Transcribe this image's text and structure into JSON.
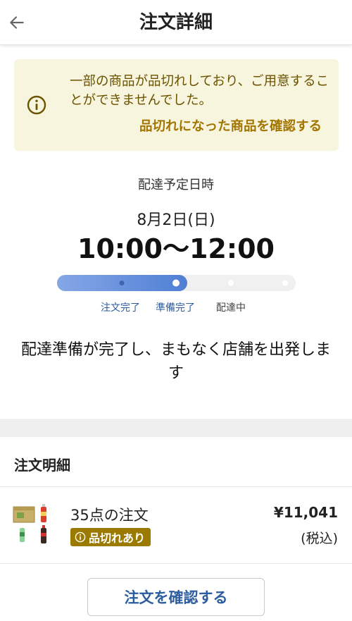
{
  "header": {
    "title": "注文詳細",
    "back_icon": "arrow-left-icon"
  },
  "alert": {
    "message": "一部の商品が品切れしており、ご用意することができませんでした。",
    "link_label": "品切れになった商品を確認する",
    "icon": "info-icon",
    "colors": {
      "background": "#f8f5de",
      "text": "#6b5300",
      "link": "#a17500"
    }
  },
  "schedule": {
    "label": "配達予定日時",
    "date": "8月2日(日)",
    "time_range": "10:00〜12:00"
  },
  "progress": {
    "steps": [
      {
        "label": "注文完了",
        "state": "done"
      },
      {
        "label": "準備完了",
        "state": "current"
      },
      {
        "label": "配達中",
        "state": "pending"
      },
      {
        "label": "",
        "state": "pending"
      }
    ],
    "colors": {
      "active": "#4f7fd4",
      "active_light": "#86a7e6",
      "track": "#f0f0f0",
      "active_label": "#2c5d9e",
      "inactive_label": "#444444"
    }
  },
  "status_message": "配達準備が完了し、まもなく店舗を出発します",
  "order_details": {
    "section_title": "注文明細",
    "count_label": "35点の注文",
    "badge": {
      "label": "品切れあり",
      "icon": "info-icon",
      "color": "#9b7a00"
    },
    "price": "¥11,041",
    "tax_label": "(税込)"
  },
  "confirm_button": {
    "label": "注文を確認する",
    "color": "#2c5d9e"
  }
}
